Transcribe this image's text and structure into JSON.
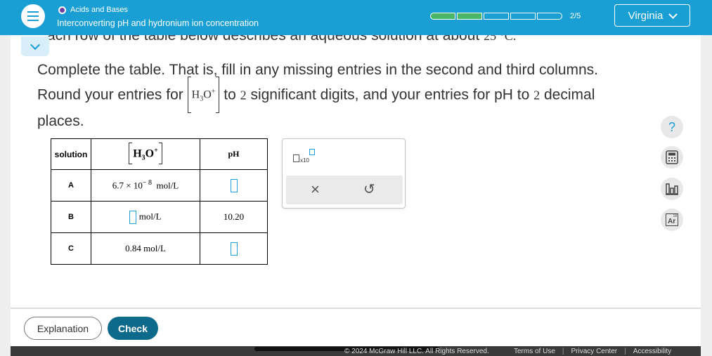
{
  "header": {
    "topic": "Acids and Bases",
    "subtitle": "Interconverting pH and hydronium ion concentration",
    "progress_label": "2/5",
    "progress_filled": 2,
    "progress_total": 5,
    "user_name": "Virginia",
    "accent_color": "#1a9fd4",
    "progress_color": "#49b667"
  },
  "problem": {
    "cut_line": "ach row of the table below describes an aqueous solution at about",
    "cut_temp": "25 °C.",
    "instr_part1": "Complete the table. That is, fill in any missing entries in the second and third columns. Round your entries for",
    "instr_part2": "to",
    "sig_figs": "2",
    "instr_part3": "significant digits, and your entries for pH to",
    "decimals": "2",
    "instr_part4": "decimal places."
  },
  "conc": {
    "species": "H",
    "sub": "3",
    "rest": "O",
    "sup": "+"
  },
  "table": {
    "header_solution": "solution",
    "header_ph": "pH",
    "rows": [
      {
        "solution": "A",
        "conc_mantissa": "6.7",
        "conc_times": "×",
        "conc_base": "10",
        "conc_exp": "− 8",
        "conc_unit": "mol/L",
        "ph": ""
      },
      {
        "solution": "B",
        "conc_unit": "mol/L",
        "ph": "10.20"
      },
      {
        "solution": "C",
        "conc_value": "0.84 mol/L",
        "ph": ""
      }
    ]
  },
  "palette": {
    "x10_label": "x10",
    "clear_glyph": "×",
    "undo_glyph": "↺"
  },
  "tools": {
    "help_glyph": "?",
    "periodic_symbol": "Ar",
    "periodic_number": "18"
  },
  "actions": {
    "explanation_label": "Explanation",
    "check_label": "Check"
  },
  "footer": {
    "copyright": "© 2024 McGraw Hill LLC. All Rights Reserved.",
    "terms": "Terms of Use",
    "privacy": "Privacy Center",
    "accessibility": "Accessibility"
  }
}
